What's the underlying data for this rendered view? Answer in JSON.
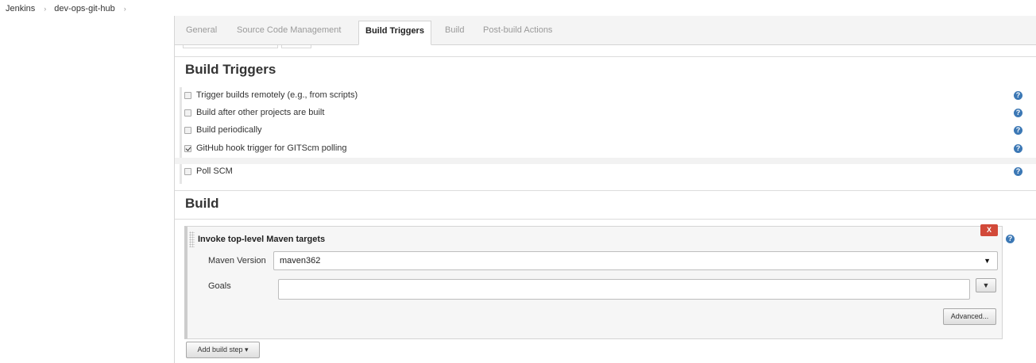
{
  "breadcrumb": {
    "root": "Jenkins",
    "project": "dev-ops-git-hub",
    "separator": "›"
  },
  "tabs": [
    {
      "label": "General",
      "active": false
    },
    {
      "label": "Source Code Management",
      "active": false
    },
    {
      "label": "Build Triggers",
      "active": true
    },
    {
      "label": "Build",
      "active": false
    },
    {
      "label": "Post-build Actions",
      "active": false
    }
  ],
  "build_triggers": {
    "title": "Build Triggers",
    "options": [
      {
        "label": "Trigger builds remotely (e.g., from scripts)",
        "checked": false
      },
      {
        "label": "Build after other projects are built",
        "checked": false
      },
      {
        "label": "Build periodically",
        "checked": false
      },
      {
        "label": "GitHub hook trigger for GITScm polling",
        "checked": true
      },
      {
        "label": "Poll SCM",
        "checked": false
      }
    ]
  },
  "build": {
    "title": "Build",
    "step": {
      "title": "Invoke top-level Maven targets",
      "maven_version_label": "Maven Version",
      "maven_version_value": "maven362",
      "goals_label": "Goals",
      "goals_value": "",
      "delete_label": "X",
      "advanced_label": "Advanced...",
      "expand_glyph": "▼"
    },
    "add_step_label": "Add build step ▾"
  },
  "icons": {
    "help": "help-icon",
    "dropdown": "chevron-down-icon"
  },
  "colors": {
    "delete_button": "#d24939",
    "help_icon": "#3c78b5",
    "tab_bar": "#f4f4f4"
  }
}
